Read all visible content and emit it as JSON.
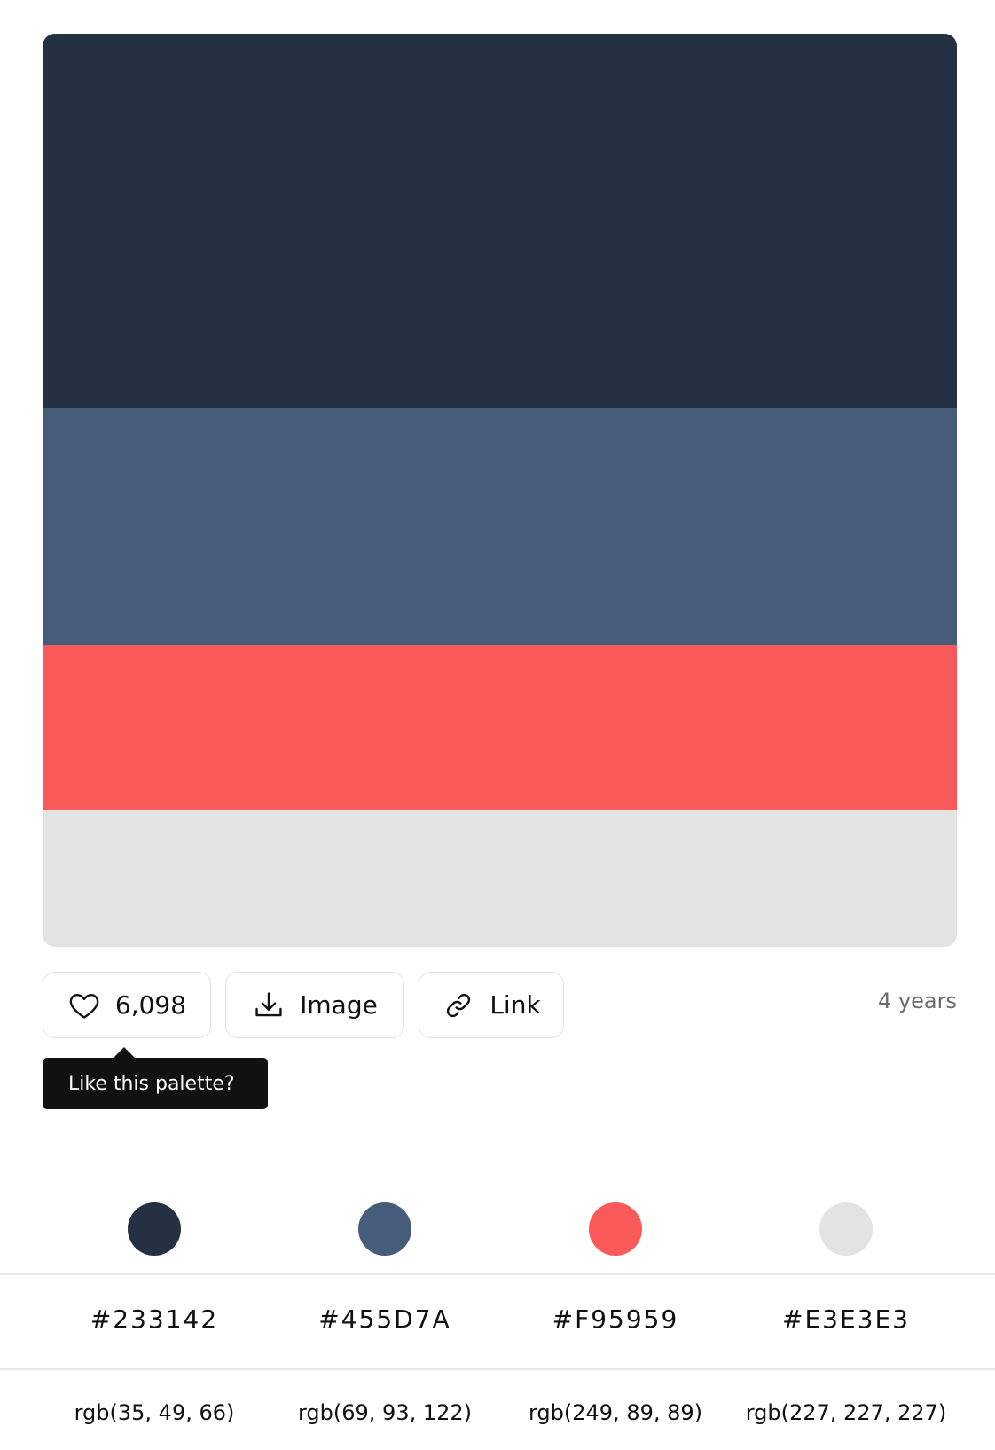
{
  "palette": {
    "colors": [
      {
        "hex": "#233142",
        "rgb": "rgb(35, 49, 66)"
      },
      {
        "hex": "#455D7A",
        "rgb": "rgb(69, 93, 122)"
      },
      {
        "hex": "#F95959",
        "rgb": "rgb(249, 89, 89)"
      },
      {
        "hex": "#E3E3E3",
        "rgb": "rgb(227, 227, 227)"
      }
    ]
  },
  "actions": {
    "like_count": "6,098",
    "image_label": "Image",
    "link_label": "Link",
    "age": "4 years"
  },
  "tooltip": {
    "text": "Like this palette?"
  },
  "icons": [
    "heart-icon",
    "download-icon",
    "link-icon"
  ]
}
